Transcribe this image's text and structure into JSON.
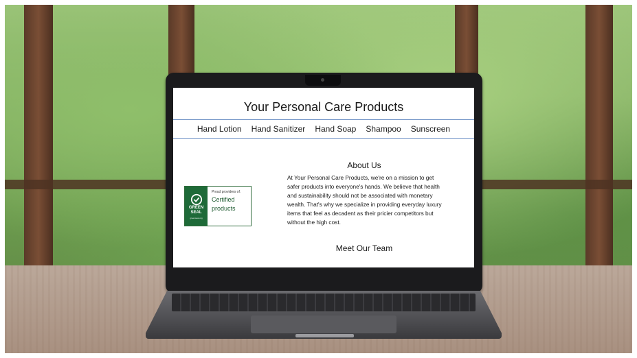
{
  "site": {
    "title": "Your Personal Care Products",
    "nav": [
      "Hand Lotion",
      "Hand Sanitizer",
      "Hand Soap",
      "Shampoo",
      "Sunscreen"
    ]
  },
  "seal": {
    "brand_line1": "GREEN",
    "brand_line2": "SEAL",
    "url": "greenseal.org",
    "proud": "Proud providers of:",
    "certified_line1": "Certified",
    "certified_line2": "products"
  },
  "about": {
    "title": "About Us",
    "body": "At Your Personal Care Products, we're on a mission to get safer products into everyone's hands. We believe that health and sustainability should not be associated with monetary wealth. That's why we specialize in providing everyday luxury items that feel as decadent as their pricier competitors but without the high cost."
  },
  "team": {
    "title": "Meet Our Team"
  },
  "colors": {
    "nav_border": "#6a8ec4",
    "seal_green": "#1e6a38"
  }
}
